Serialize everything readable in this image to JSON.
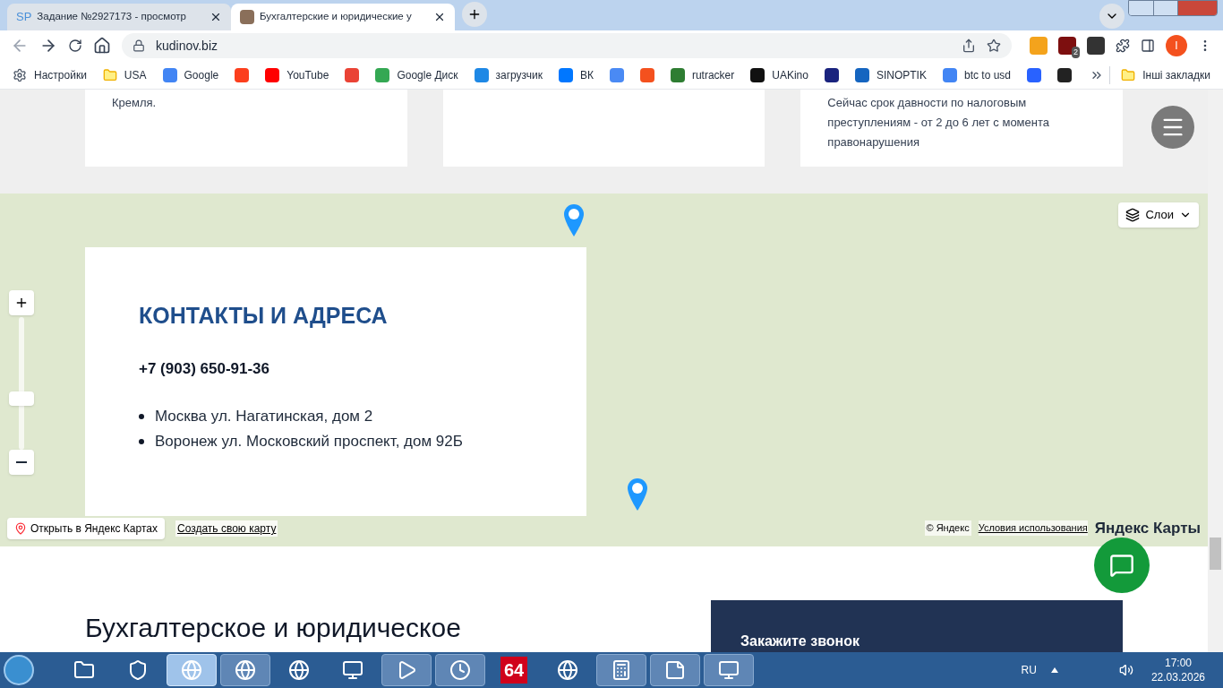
{
  "browser": {
    "tabs": [
      {
        "title": "Задание №2927173 - просмотр",
        "favicon": "SP",
        "selected": false
      },
      {
        "title": "Бухгалтерские и юридические у",
        "selected": true
      }
    ],
    "url": "kudinov.biz",
    "extension_badge": "2",
    "profile_initial": "I",
    "bookmarks": [
      {
        "kind": "gear",
        "label": "Настройки"
      },
      {
        "kind": "folder",
        "label": "USA"
      },
      {
        "kind": "site",
        "label": "Google",
        "color": "#4285f4"
      },
      {
        "kind": "icon",
        "color": "#fc3f1d"
      },
      {
        "kind": "site",
        "label": "YouTube",
        "color": "#ff0000"
      },
      {
        "kind": "icon",
        "color": "#ea4335"
      },
      {
        "kind": "site",
        "label": "Google Диск",
        "color": "#34a853"
      },
      {
        "kind": "site",
        "label": "загрузчик",
        "color": "#1e88e5"
      },
      {
        "kind": "site",
        "label": "ВК",
        "color": "#0077ff"
      },
      {
        "kind": "icon",
        "color": "#4a8af4"
      },
      {
        "kind": "icon",
        "color": "#f4511e"
      },
      {
        "kind": "site",
        "label": "rutracker",
        "color": "#2e7d32"
      },
      {
        "kind": "site",
        "label": "UAKino",
        "color": "#111111"
      },
      {
        "kind": "icon",
        "color": "#1a237e"
      },
      {
        "kind": "site",
        "label": "SINOPTIK",
        "color": "#1565c0"
      },
      {
        "kind": "site",
        "label": "btc to usd",
        "color": "#4285f4"
      },
      {
        "kind": "icon",
        "color": "#2962ff"
      },
      {
        "kind": "icon",
        "color": "#222222"
      }
    ],
    "other_bookmarks": "Інші закладки"
  },
  "cards": [
    {
      "kind": "text",
      "text": "Кремля."
    },
    {
      "kind": "blank"
    },
    {
      "kind": "text",
      "text": "Сейчас срок давности по налоговым преступлениям - от 2 до 6 лет с момента правонарушения"
    }
  ],
  "contacts": {
    "title": "КОНТАКТЫ И АДРЕСА",
    "phone": "+7 (903) 650-91-36",
    "addresses": [
      "Москва ул. Нагатинская, дом 2",
      "Воронеж ул. Московский проспект, дом 92Б"
    ]
  },
  "map": {
    "zoom": {
      "level": 0.37
    },
    "layers": "Слои",
    "open_link": "Открыть в Яндекс Картах",
    "create_link": "Создать свою карту",
    "copyright": "© Яндекс",
    "terms": "Условия использования",
    "logo": "Яндекс Карты"
  },
  "section": {
    "heading": "Бухгалтерское и юридическое",
    "callback_title": "Закажите звонок"
  },
  "taskbar": {
    "apps": [
      {
        "kind": "folder"
      },
      {
        "kind": "shield"
      },
      {
        "kind": "chrome",
        "selected": true
      },
      {
        "kind": "globe",
        "selected": false
      },
      {
        "kind": "yandex"
      },
      {
        "kind": "board"
      },
      {
        "kind": "player",
        "selected": false
      },
      {
        "kind": "clock",
        "selected": false
      },
      {
        "kind": "text",
        "label": "64"
      },
      {
        "kind": "umbrella"
      },
      {
        "kind": "calc",
        "selected": false
      },
      {
        "kind": "notes",
        "selected": false
      },
      {
        "kind": "monitor",
        "selected": false
      }
    ],
    "language": "RU",
    "time": "17:00",
    "date": "22.03.2026"
  }
}
